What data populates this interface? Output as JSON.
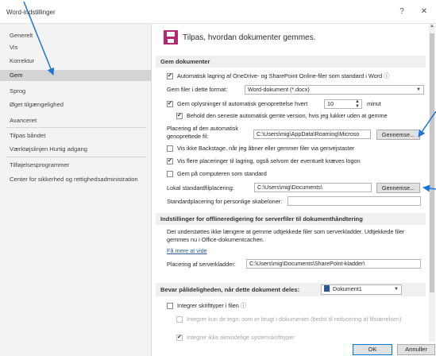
{
  "window": {
    "title": "Word-indstillinger",
    "help_glyph": "?",
    "close_glyph": "✕"
  },
  "sidebar": {
    "items": [
      {
        "label": "Generelt"
      },
      {
        "label": "Vis"
      },
      {
        "label": "Korrektur"
      },
      {
        "label": "Gem",
        "selected": true
      },
      {
        "label": "Sprog"
      },
      {
        "label": "Øget tilgængelighed"
      },
      {
        "label": "Avanceret"
      },
      {
        "label": "Tilpas båndet"
      },
      {
        "label": "Værktøjslinjen Hurtig adgang"
      },
      {
        "label": "Tilføjelsesprogrammer"
      },
      {
        "label": "Center for sikkerhed og rettighedsadministration"
      }
    ]
  },
  "main": {
    "header": "Tilpas, hvordan dokumenter gemmes.",
    "save_section": {
      "title": "Gem dokumenter",
      "autosave_label": "Automatisk lagring af OneDrive- og SharePoint Online-filer som standard i Word",
      "info_glyph": "ⓘ",
      "format_label": "Gem filer i dette format:",
      "format_value": "Word-dokument (*.docx)",
      "autorecover_label": "Gem oplysninger til automatisk genoprettelse hvert",
      "autorecover_minutes": "10",
      "minutes_label": "minut",
      "keep_last_label": "Behold den seneste automatisk gemte version, hvis jeg lukker uden at gemme",
      "autorecover_location_label": "Placering af den automatisk genoprettede fil:",
      "autorecover_location_value": "C:\\Users\\mig\\AppData\\Roaming\\Microso",
      "browse_label": "Gennemse...",
      "no_backstage_label": "Vis ikke Backstage, når jeg åbner eller gemmer filer via genvejstaster",
      "show_more_places_label": "Vis flere placeringer til lagring, også selvom der eventuelt kræves logon",
      "save_to_computer_label": "Gem på computeren som standard",
      "local_location_label": "Lokal standardfilplacering:",
      "local_location_value": "C:\\Users\\mig\\Documents\\",
      "browse2_label": "Gennemse...",
      "personal_templates_label": "Standardplacering for personlige skabeloner:",
      "personal_templates_value": ""
    },
    "offline_section": {
      "title": "Indstillinger for offlineredigering for serverfiler til dokumenthåndtering",
      "description": "Det understøttes ikke længere at gemme udtjekkede filer som serverkladder. Udtjekkede filer gemmes nu i Office-dokumentcachen.",
      "learn_more": "Få mere at vide",
      "drafts_label": "Placering af serverkladder:",
      "drafts_value": "C:\\Users\\mig\\Documents\\SharePoint-kladder\\"
    },
    "fidelity_section": {
      "title": "Bevar pålideligheden, når dette dokument deles:",
      "document_value": "Dokument1",
      "embed_fonts_label": "Integrer skrifttyper i filen",
      "embed_used_label": "Integrer kun de tegn, som er brugt i dokumentet (bedst til reducering af filstørrelsen)",
      "no_common_label": "Integrer ikke almindelige systemskrifttyper"
    }
  },
  "footer": {
    "ok_label": "OK",
    "cancel_label": "Annuller"
  },
  "colors": {
    "accent": "#2b579a",
    "arrow": "#1c74d4",
    "selected": "#d4d4d4"
  }
}
